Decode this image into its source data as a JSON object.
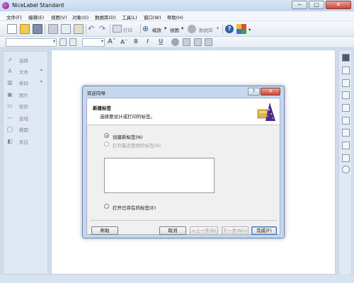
{
  "app": {
    "title": "NiceLabel Standard"
  },
  "window_buttons": {
    "minimize": "─",
    "maximize": "□",
    "close": "✕"
  },
  "menu": [
    "文件(F)",
    "编辑(E)",
    "视图(V)",
    "对象(O)",
    "数据库(D)",
    "工具(L)",
    "窗口(W)",
    "帮助(H)"
  ],
  "toolbar": {
    "print_label": "打印",
    "zoom_label": "缩放",
    "view_label": "视图",
    "database_label": "数据库"
  },
  "format_toolbar": {
    "bold": "B",
    "italic": "I",
    "underline": "U"
  },
  "left_tools": [
    {
      "label": "选择",
      "icon": "arrow-cursor-icon"
    },
    {
      "label": "文本",
      "icon": "text-icon"
    },
    {
      "label": "条码",
      "icon": "barcode-icon"
    },
    {
      "label": "图片",
      "icon": "picture-icon"
    },
    {
      "label": "矩形",
      "icon": "rectangle-icon"
    },
    {
      "label": "直线",
      "icon": "line-icon"
    },
    {
      "label": "椭圆",
      "icon": "ellipse-icon"
    },
    {
      "label": "反白",
      "icon": "inverse-icon"
    }
  ],
  "dialog": {
    "title": "欢迎向导",
    "help_btn": "?",
    "close_btn": "✕",
    "header_title": "新建标签",
    "header_subtitle": "选择要设计或打印的标签。",
    "options": {
      "create_new": "创建新标签(N)",
      "open_recent": "打开最近使用的标签(R)",
      "open_existing": "打开已存在的标签(E)"
    },
    "selected_option": "create_new",
    "buttons": {
      "help": "帮助",
      "cancel": "取消",
      "back": "<上一步(B)",
      "next": "下一步(N)>",
      "finish": "完成(F)"
    }
  }
}
